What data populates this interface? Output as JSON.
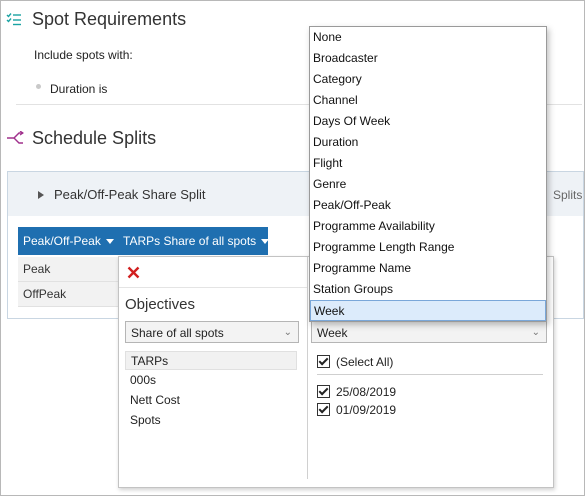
{
  "spot_requirements": {
    "title": "Spot Requirements",
    "include_label": "Include spots with:",
    "condition": "Duration is"
  },
  "schedule_splits": {
    "title": "Schedule Splits",
    "split_name": "Peak/Off-Peak Share Split",
    "right_label": "Splits",
    "columns": [
      {
        "label": "Peak/Off-Peak"
      },
      {
        "label": "TARPs Share of all spots"
      }
    ],
    "rows": [
      "Peak",
      "OffPeak"
    ]
  },
  "popup": {
    "objectives_title": "Objectives",
    "objective_combo": "Share of all spots",
    "objectives": [
      "TARPs",
      "000s",
      "Nett Cost",
      "Spots"
    ],
    "selected_objective_index": 0,
    "period_combo": "Week",
    "select_all_label": "(Select All)",
    "weeks": [
      "25/08/2019",
      "01/09/2019"
    ]
  },
  "dropdown": {
    "items": [
      "None",
      "Broadcaster",
      "Category",
      "Channel",
      "Days Of Week",
      "Duration",
      "Flight",
      "Genre",
      "Peak/Off-Peak",
      "Programme Availability",
      "Programme Length Range",
      "Programme Name",
      "Station Groups",
      "Week"
    ],
    "selected_index": 13
  },
  "colors": {
    "header_blue": "#1f6fb0",
    "close_red": "#d11f1f",
    "selection_bg": "#dcebfb",
    "spot_icon": "#1aa3a3",
    "splits_icon": "#a0308c"
  }
}
